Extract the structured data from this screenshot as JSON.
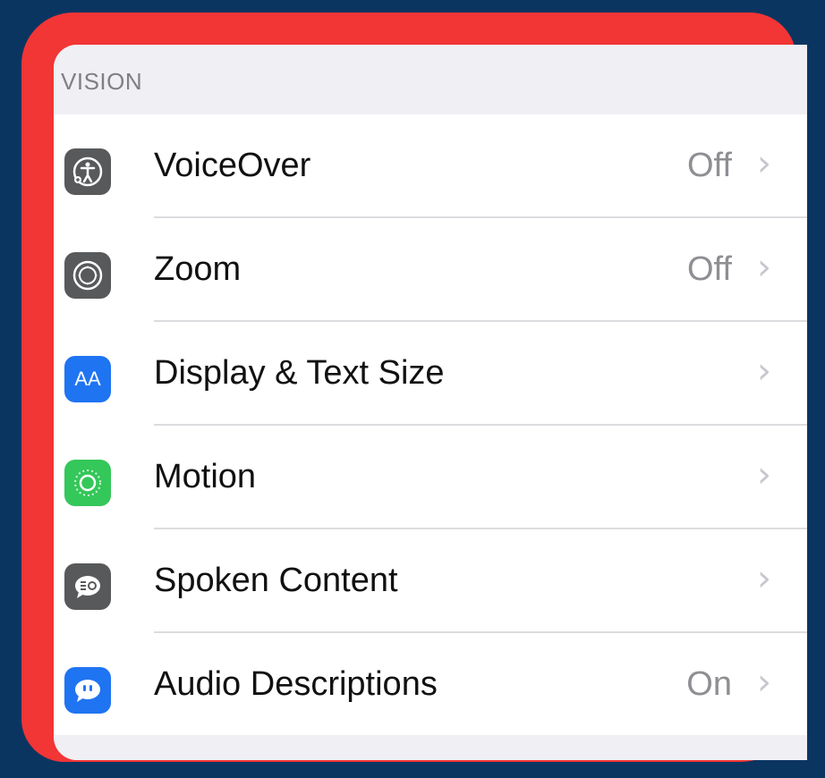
{
  "section": {
    "header": "VISION"
  },
  "rows": [
    {
      "label": "VoiceOver",
      "value": "Off",
      "icon": "voiceover-icon",
      "color": "#58595b"
    },
    {
      "label": "Zoom",
      "value": "Off",
      "icon": "zoom-icon",
      "color": "#58595b"
    },
    {
      "label": "Display & Text Size",
      "value": "",
      "icon": "display-text-size-icon",
      "color": "#1f74f2",
      "icon_text": "AA"
    },
    {
      "label": "Motion",
      "value": "",
      "icon": "motion-icon",
      "color": "#34c759"
    },
    {
      "label": "Spoken Content",
      "value": "",
      "icon": "spoken-content-icon",
      "color": "#58595b"
    },
    {
      "label": "Audio Descriptions",
      "value": "On",
      "icon": "audio-descriptions-icon",
      "color": "#1f74f2"
    }
  ],
  "chevron": "›"
}
